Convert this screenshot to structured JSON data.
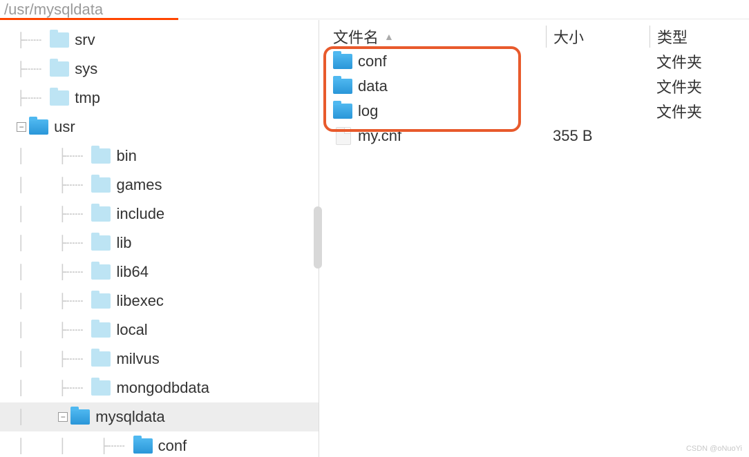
{
  "path": "/usr/mysqldata",
  "tree": [
    {
      "label": "srv",
      "depth": 0,
      "icon": "light",
      "toggle": null,
      "selected": false
    },
    {
      "label": "sys",
      "depth": 0,
      "icon": "light",
      "toggle": null,
      "selected": false
    },
    {
      "label": "tmp",
      "depth": 0,
      "icon": "light",
      "toggle": null,
      "selected": false
    },
    {
      "label": "usr",
      "depth": 0,
      "icon": "blue",
      "toggle": "minus",
      "selected": false
    },
    {
      "label": "bin",
      "depth": 1,
      "icon": "light",
      "toggle": null,
      "selected": false
    },
    {
      "label": "games",
      "depth": 1,
      "icon": "light",
      "toggle": null,
      "selected": false
    },
    {
      "label": "include",
      "depth": 1,
      "icon": "light",
      "toggle": null,
      "selected": false
    },
    {
      "label": "lib",
      "depth": 1,
      "icon": "light",
      "toggle": null,
      "selected": false
    },
    {
      "label": "lib64",
      "depth": 1,
      "icon": "light",
      "toggle": null,
      "selected": false
    },
    {
      "label": "libexec",
      "depth": 1,
      "icon": "light",
      "toggle": null,
      "selected": false
    },
    {
      "label": "local",
      "depth": 1,
      "icon": "light",
      "toggle": null,
      "selected": false
    },
    {
      "label": "milvus",
      "depth": 1,
      "icon": "light",
      "toggle": null,
      "selected": false
    },
    {
      "label": "mongodbdata",
      "depth": 1,
      "icon": "light",
      "toggle": null,
      "selected": false
    },
    {
      "label": "mysqldata",
      "depth": 1,
      "icon": "blue",
      "toggle": "minus",
      "selected": true
    },
    {
      "label": "conf",
      "depth": 2,
      "icon": "blue",
      "toggle": null,
      "selected": false
    }
  ],
  "columns": {
    "name": "文件名",
    "size": "大小",
    "type": "类型"
  },
  "files": [
    {
      "name": "conf",
      "size": "",
      "type": "文件夹",
      "icon": "folder"
    },
    {
      "name": "data",
      "size": "",
      "type": "文件夹",
      "icon": "folder"
    },
    {
      "name": "log",
      "size": "",
      "type": "文件夹",
      "icon": "folder"
    },
    {
      "name": "my.cnf",
      "size": "355 B",
      "type": "",
      "icon": "file"
    }
  ],
  "watermark": "CSDN @oNuoYi"
}
